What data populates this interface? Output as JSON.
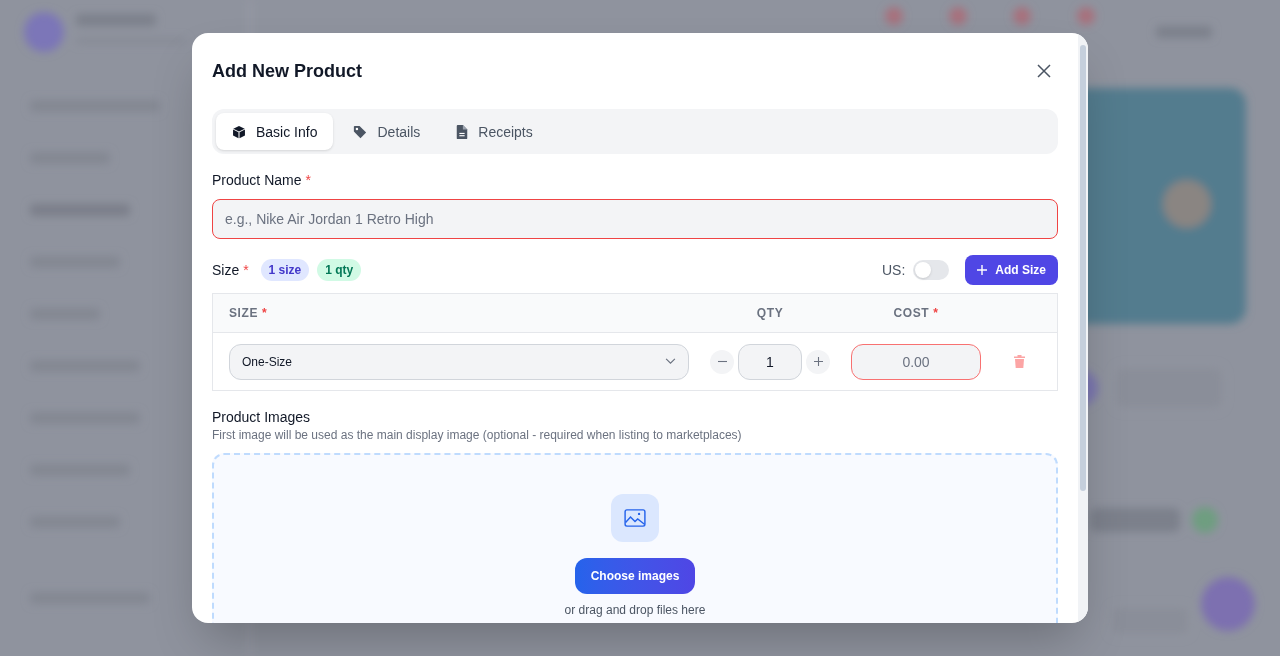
{
  "dialog": {
    "title": "Add New Product",
    "tabs": [
      {
        "label": "Basic Info",
        "selected": true
      },
      {
        "label": "Details",
        "selected": false
      },
      {
        "label": "Receipts",
        "selected": false
      }
    ],
    "product_name": {
      "label": "Product Name",
      "required_mark": "*",
      "placeholder": "e.g., Nike Air Jordan 1 Retro High",
      "invalid": true
    },
    "sizes": {
      "label": "Size",
      "required_mark": "*",
      "badges": [
        {
          "text": "1 size",
          "color": "#e0e7ff"
        },
        {
          "text": "1 qty",
          "color": "#d1fae5"
        }
      ],
      "us_toggle": {
        "label": "US:",
        "on": false
      },
      "add_button": "Add Size",
      "table": {
        "columns": [
          {
            "label": "SIZE",
            "required_mark": "*"
          },
          {
            "label": "QTY"
          },
          {
            "label": "COST",
            "required_mark": "*"
          }
        ],
        "rows": [
          {
            "size": "One-Size",
            "qty": "1",
            "cost_placeholder": "0.00",
            "cost_invalid": true
          }
        ]
      }
    },
    "images": {
      "label": "Product Images",
      "hint": "First image will be used as the main display image (optional - required when listing to marketplaces)",
      "button": "Choose images",
      "drop_text": "or drag and drop files here"
    }
  }
}
